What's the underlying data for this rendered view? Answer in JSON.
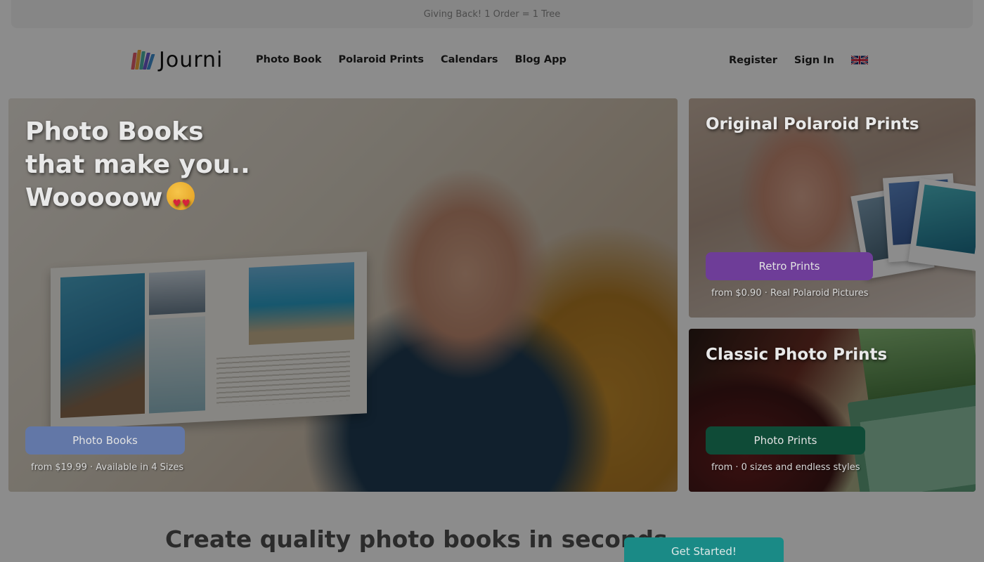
{
  "banner": {
    "text": "Giving Back! 1 Order = 1 Tree"
  },
  "logo": {
    "text": "Journi",
    "bar_colors": [
      "#e35d6a",
      "#f2a93b",
      "#4bb3a6",
      "#6a5acd",
      "#3e8ed0"
    ]
  },
  "nav": {
    "links": [
      "Photo Book",
      "Polaroid Prints",
      "Calendars",
      "Blog App"
    ],
    "register": "Register",
    "sign_in": "Sign In",
    "language_icon": "uk-flag-icon"
  },
  "hero": {
    "title_lines": [
      "Photo Books",
      "that make you..",
      "Wooooow"
    ],
    "emoji": "heart-eyes-emoji",
    "button": "Photo Books",
    "button_color": "#4a73d4",
    "note": "from $19.99 · Available in 4 Sizes"
  },
  "polaroid_card": {
    "title": "Original Polaroid Prints",
    "button": "Retro Prints",
    "button_color": "#8e3cde",
    "note": "from $0.90 · Real Polaroid Pictures"
  },
  "classic_card": {
    "title": "Classic Photo Prints",
    "button": "Photo Prints",
    "button_color": "#0c6b4c",
    "note": "from · 0 sizes and endless styles"
  },
  "section": {
    "title": "Create quality photo books in seconds",
    "cta": "Get Started!"
  }
}
